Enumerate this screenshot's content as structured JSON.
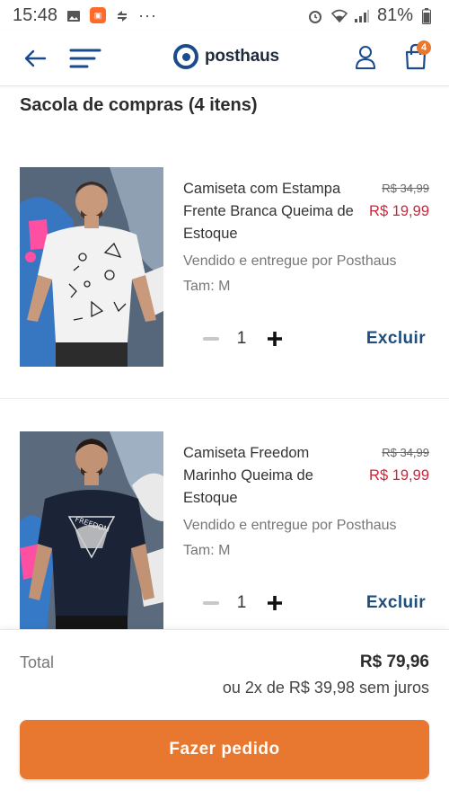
{
  "status_bar": {
    "time": "15:48",
    "battery": "81%",
    "dots": "···"
  },
  "header": {
    "logo_text": "posthaus",
    "cart_count": "4"
  },
  "page": {
    "title": "Sacola de compras (4 itens)"
  },
  "products": [
    {
      "name": "Camiseta com Estampa Frente Branca Queima de Estoque",
      "old_price": "R$ 34,99",
      "price": "R$ 19,99",
      "seller": "Vendido e entregue por Posthaus",
      "size": "Tam: M",
      "quantity": "1",
      "remove_label": "Excluir",
      "shirt_color": "#f2f2f2"
    },
    {
      "name": "Camiseta Freedom Marinho Queima de Estoque",
      "old_price": "R$ 34,99",
      "price": "R$ 19,99",
      "seller": "Vendido e entregue por Posthaus",
      "size": "Tam: M",
      "quantity": "1",
      "remove_label": "Excluir",
      "shirt_color": "#1b2436"
    }
  ],
  "summary": {
    "total_label": "Total",
    "total_value": "R$ 79,96",
    "installments": "ou 2x de R$ 39,98 sem juros",
    "checkout_label": "Fazer pedido"
  },
  "colors": {
    "accent": "#e8782f",
    "brand": "#1a4b8c",
    "sale_price": "#d0243c",
    "remove_link": "#1d4d7c"
  }
}
